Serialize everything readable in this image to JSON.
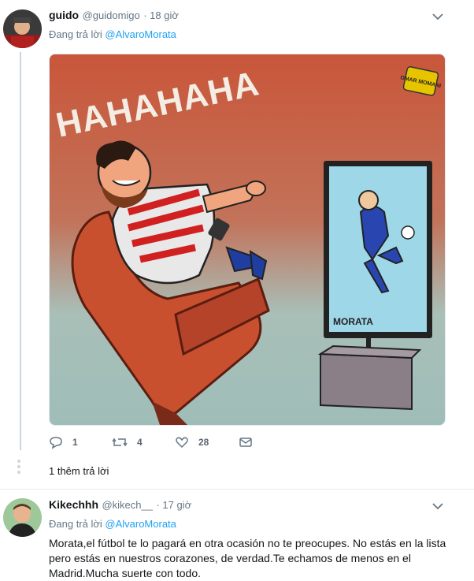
{
  "tweet1": {
    "name": "guido",
    "handle": "@guidomigo",
    "time": "· 18 giờ",
    "replying_prefix": "Đang trả lời ",
    "replying_to": "@AlvaroMorata",
    "image": {
      "laugh_text": "HAHAHAHA",
      "tv_caption": "MORATA",
      "signature": "OMAR MOMANI"
    },
    "actions": {
      "reply_count": "1",
      "retweet_count": "4",
      "like_count": "28"
    },
    "more_replies": "1 thêm trả lời"
  },
  "tweet2": {
    "name": "Kikechhh",
    "handle": "@kikech__",
    "time": "· 17 giờ",
    "replying_prefix": "Đang trả lời ",
    "replying_to": "@AlvaroMorata",
    "text": "Morata,el fútbol te lo pagará en otra ocasión no te preocupes. No estás en la lista pero estás en nuestros corazones, de verdad.Te echamos de menos en el Madrid.Mucha suerte con todo."
  },
  "colors": {
    "link": "#1da1f2",
    "secondary": "#657786",
    "bg_orange": "#d0603c",
    "bg_teal": "#a6c4bf"
  }
}
